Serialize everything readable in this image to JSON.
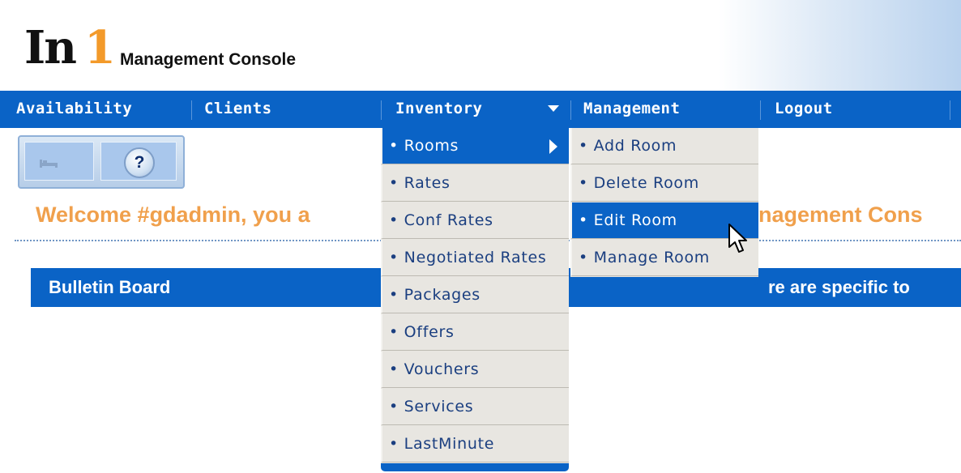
{
  "header": {
    "logo_in": "In",
    "logo_one": "1",
    "subtitle": "Management Console"
  },
  "nav": {
    "items": [
      "Availability",
      "Clients",
      "Inventory",
      "Management",
      "Logout"
    ]
  },
  "toolbar": {
    "bed_icon": "bed-icon",
    "help_label": "?"
  },
  "welcome": {
    "left_text": "Welcome #gdadmin, you a",
    "right_text": "nagement Cons"
  },
  "bulletin": {
    "title": "Bulletin Board",
    "right_text": "re are specific to"
  },
  "inventory_menu": {
    "items": [
      "Rooms",
      "Rates",
      "Conf Rates",
      "Negotiated Rates",
      "Packages",
      "Offers",
      "Vouchers",
      "Services",
      "LastMinute"
    ],
    "selected": "Rooms"
  },
  "rooms_submenu": {
    "items": [
      "Add Room",
      "Delete Room",
      "Edit Room",
      "Manage Room"
    ],
    "selected": "Edit Room"
  },
  "colors": {
    "nav_blue": "#0a63c6",
    "menu_bg": "#e8e6e1",
    "welcome_orange": "#f0a04c"
  }
}
